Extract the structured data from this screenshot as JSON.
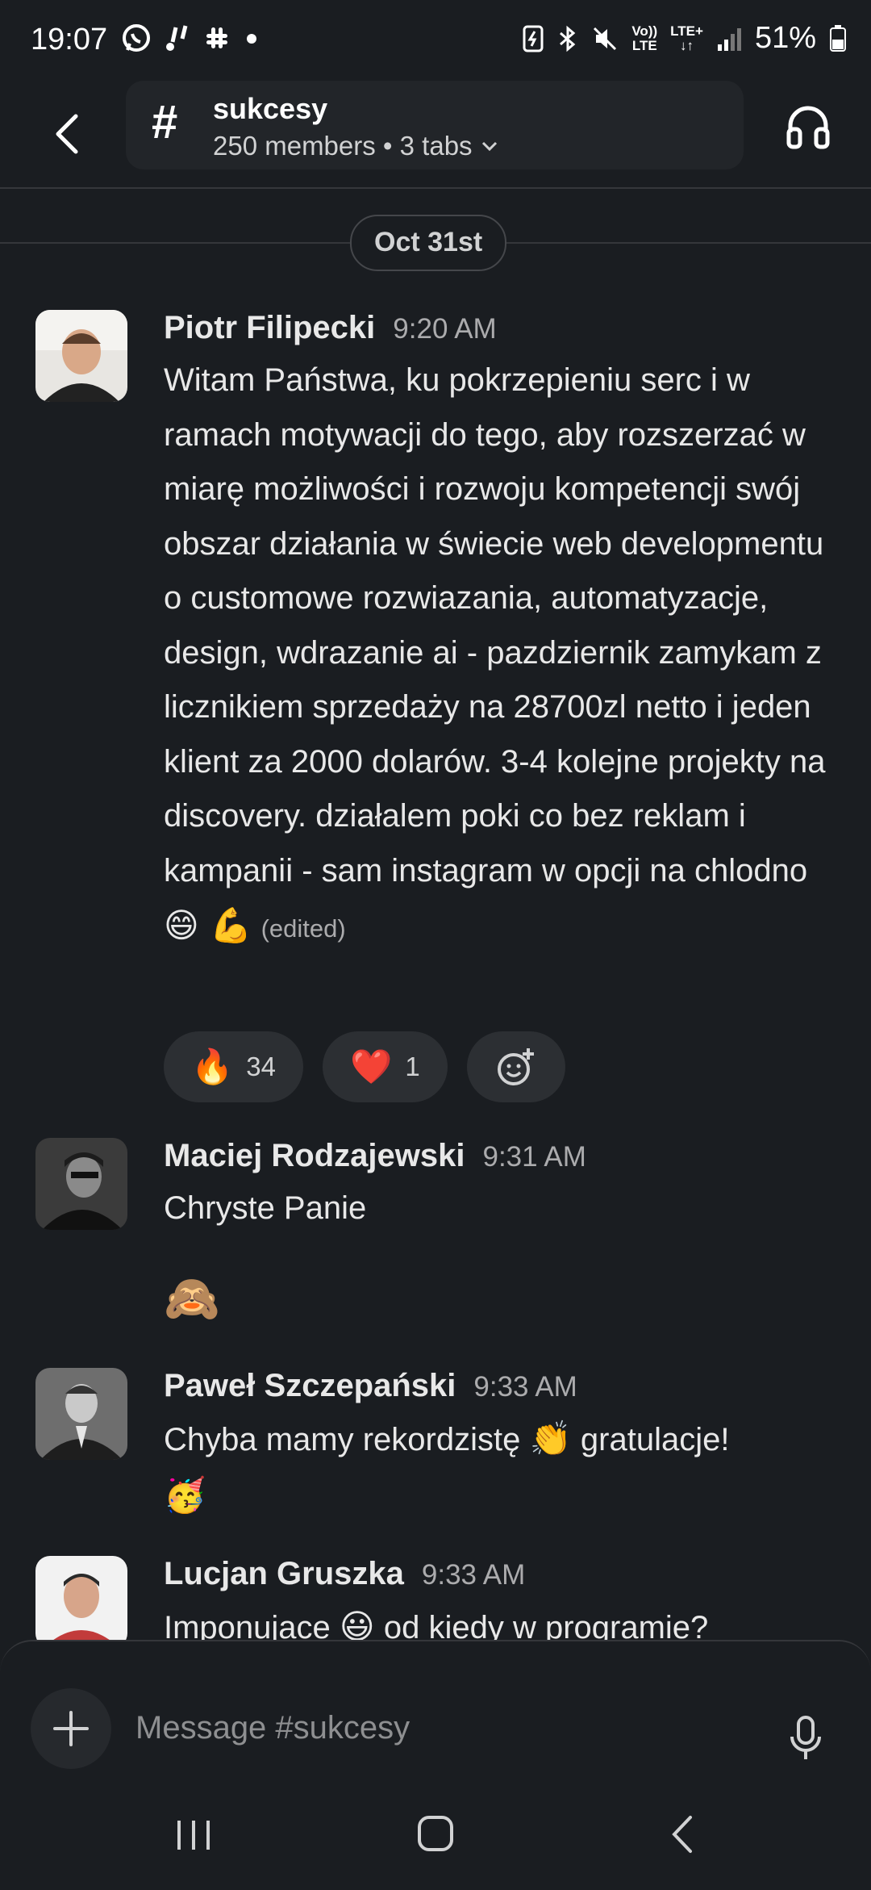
{
  "status_bar": {
    "time": "19:07",
    "battery": "51%",
    "network_top": "Vo))",
    "network_bottom": "LTE",
    "lte_plus": "LTE+"
  },
  "header": {
    "channel_name": "sukcesy",
    "subtitle": "250 members • 3 tabs"
  },
  "date_divider": "Oct 31st",
  "messages": [
    {
      "author": "Piotr Filipecki",
      "time": "9:20 AM",
      "text": "Witam Państwa, ku pokrzepieniu serc i w ramach motywacji do tego, aby rozszerzać w miarę możliwości i rozwoju kompetencji swój obszar działania w świecie web developmentu o customowe rozwiazania, automatyzacje, design, wdrazanie ai - pazdziernik zamykam z licznikiem sprzedaży na 28700zl netto i jeden klient za 2000 dolarów. 3-4 kolejne projekty na discovery. działalem poki co bez reklam i kampanii - sam instagram w opcji na chlodno",
      "emojis": "😄 💪",
      "edited": "(edited)",
      "reactions": [
        {
          "emoji": "🔥",
          "count": "34"
        },
        {
          "emoji": "❤️",
          "count": "1"
        }
      ]
    },
    {
      "author": "Maciej Rodzajewski",
      "time": "9:31 AM",
      "text": "Chryste Panie",
      "extra_emoji": "🙈"
    },
    {
      "author": "Paweł Szczepański",
      "time": "9:33 AM",
      "text_before": "Chyba mamy rekordzistę",
      "inline_emoji": "👏",
      "text_after": "gratulacje!",
      "trailing_emoji": "🥳"
    },
    {
      "author": "Lucjan Gruszka",
      "time": "9:33 AM",
      "text_before": "Imponujace",
      "inline_emoji": "😃",
      "text_after": "od kiedy w programie?"
    }
  ],
  "composer": {
    "placeholder": "Message #sukcesy"
  },
  "colors": {
    "background": "#1a1d21",
    "pill": "#222529",
    "reaction_bg": "#2c2f33"
  }
}
